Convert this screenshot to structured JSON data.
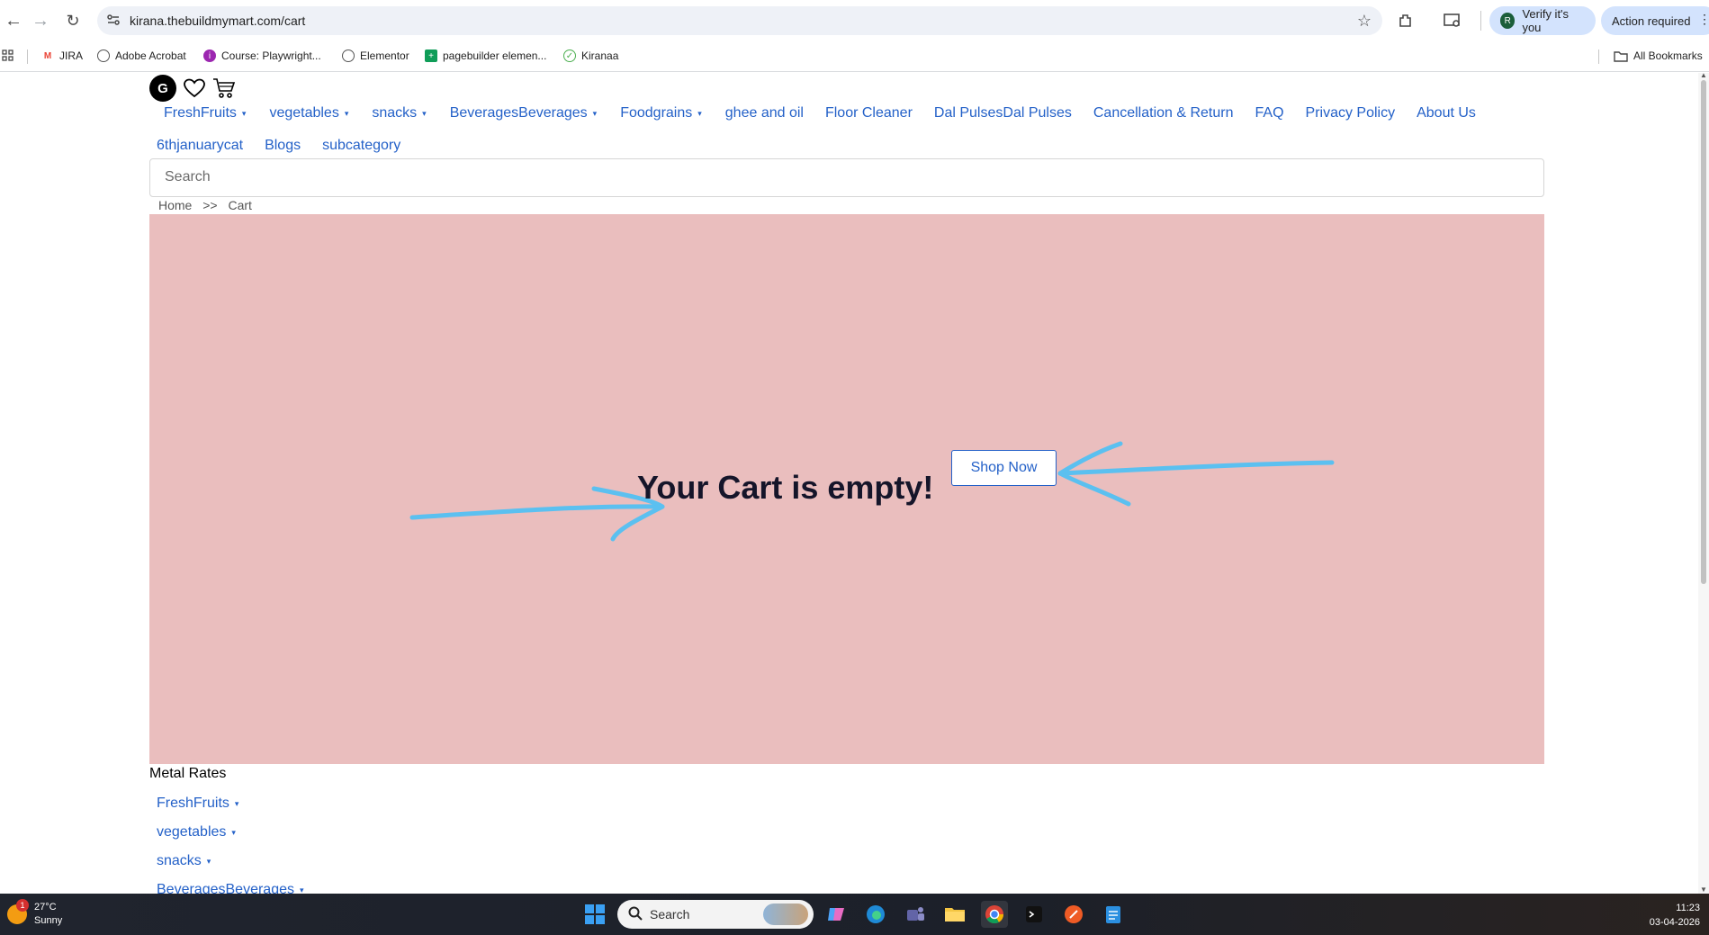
{
  "browser": {
    "url": "kirana.thebuildmymart.com/cart",
    "verify_label": "Verify it's you",
    "verify_avatar": "R",
    "action_label": "Action required",
    "bookmarks": [
      "JIRA",
      "Adobe Acrobat",
      "Course: Playwright...",
      "Elementor",
      "pagebuilder elemen...",
      "Kiranaa"
    ],
    "all_bookmarks": "All Bookmarks"
  },
  "header": {
    "avatar_letter": "G",
    "menu_row1": [
      {
        "label": "FreshFruits",
        "dropdown": true
      },
      {
        "label": "vegetables",
        "dropdown": true
      },
      {
        "label": "snacks",
        "dropdown": true
      },
      {
        "label": "BeveragesBeverages",
        "dropdown": true
      },
      {
        "label": "Foodgrains",
        "dropdown": true
      },
      {
        "label": "ghee and oil",
        "dropdown": false
      },
      {
        "label": "Floor Cleaner",
        "dropdown": false
      },
      {
        "label": "Dal PulsesDal Pulses",
        "dropdown": false
      },
      {
        "label": "Cancellation & Return",
        "dropdown": false
      },
      {
        "label": "FAQ",
        "dropdown": false
      },
      {
        "label": "Privacy Policy",
        "dropdown": false
      },
      {
        "label": "About Us",
        "dropdown": false
      }
    ],
    "menu_row2": [
      {
        "label": "6thjanuarycat"
      },
      {
        "label": "Blogs"
      },
      {
        "label": "subcategory"
      }
    ],
    "search_placeholder": "Search"
  },
  "breadcrumb": {
    "home": "Home",
    "sep": ">>",
    "current": "Cart"
  },
  "cart": {
    "empty_message": "Your Cart is empty!",
    "shop_now": "Shop Now"
  },
  "footer": {
    "metal_rates": "Metal Rates",
    "links": [
      "FreshFruits",
      "vegetables",
      "snacks",
      "BeveragesBeverages"
    ]
  },
  "taskbar": {
    "temperature": "27°C",
    "condition": "Sunny",
    "weather_badge": "1",
    "search_label": "Search",
    "time": "11:23",
    "date": "03-04-2026"
  },
  "colors": {
    "link": "#2461c8",
    "cart_bg": "#eabebe",
    "arrow": "#5bc0f0"
  }
}
